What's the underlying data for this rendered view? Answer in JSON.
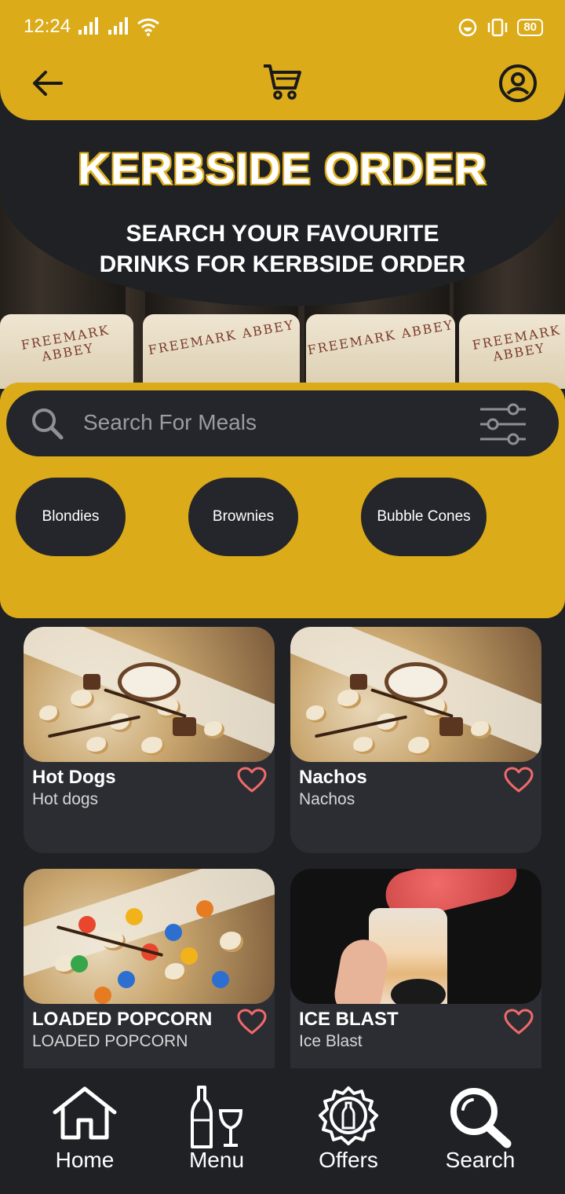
{
  "status_bar": {
    "time": "12:24",
    "battery": "80"
  },
  "header": {
    "back_icon": "arrow-left-icon",
    "cart_icon": "cart-icon",
    "profile_icon": "profile-icon"
  },
  "hero": {
    "title": "KERBSIDE ORDER",
    "subtitle_line1": "SEARCH YOUR FAVOURITE",
    "subtitle_line2": "DRINKS FOR KERBSIDE ORDER",
    "label_text": "FREEMARK ABBEY"
  },
  "search": {
    "placeholder": "Search For Meals"
  },
  "categories": [
    "Blondies",
    "Brownies",
    "Bubble Cones"
  ],
  "items": [
    {
      "title": "Hot Dogs",
      "subtitle": "Hot dogs"
    },
    {
      "title": "Nachos",
      "subtitle": "Nachos"
    },
    {
      "title": "LOADED POPCORN",
      "subtitle": "LOADED POPCORN"
    },
    {
      "title": "ICE BLAST",
      "subtitle": "Ice Blast"
    }
  ],
  "nav": [
    {
      "label": "Home",
      "icon": "home-icon"
    },
    {
      "label": "Menu",
      "icon": "drinks-icon"
    },
    {
      "label": "Offers",
      "icon": "offer-badge-icon"
    },
    {
      "label": "Search",
      "icon": "search-icon"
    }
  ],
  "colors": {
    "accent": "#dbab19",
    "background": "#1f2125",
    "card": "#2b2d33",
    "heart": "#f06a6a"
  }
}
